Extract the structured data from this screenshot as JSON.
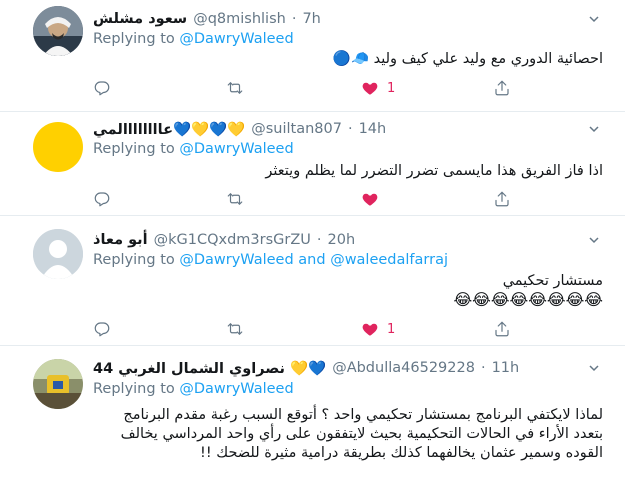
{
  "tweets": [
    {
      "name": "سعود مشلش",
      "handle": "@q8mishlish",
      "time": "7h",
      "replying_prefix": "Replying to",
      "replying_to": "@DawryWaleed",
      "replying_and": "",
      "replying_to2": "",
      "text": "احصائية الدوري مع وليد علي كيف وليد 🧢🔵",
      "text2": "",
      "likes": "1",
      "liked": true
    },
    {
      "name": "عاااااااالمي💙💛💙💛",
      "handle": "@suiltan807",
      "time": "14h",
      "replying_prefix": "Replying to",
      "replying_to": "@DawryWaleed",
      "replying_and": "",
      "replying_to2": "",
      "text": "اذا فاز الفريق هذا مايسمى تضرر التضرر لما يظلم ويتعثر",
      "text2": "",
      "likes": "",
      "liked": true
    },
    {
      "name": "أبو معاذ",
      "handle": "@kG1CQxdm3rsGrZU",
      "time": "20h",
      "replying_prefix": "Replying to",
      "replying_to": "@DawryWaleed",
      "replying_and": "and",
      "replying_to2": "@waleedalfarraj",
      "text": "مستشار تحكيمي",
      "text2": "😂😂😂😂😂😂😂😂",
      "likes": "1",
      "liked": true
    },
    {
      "name": "نصراوي الشمال الغربي 44 💛💙",
      "handle": "@Abdulla46529228",
      "time": "11h",
      "replying_prefix": "Replying to",
      "replying_to": "@DawryWaleed",
      "replying_and": "",
      "replying_to2": "",
      "text": "لماذا لايكتفي البرنامج بمستشار تحكيمي واحد ؟ أتوقع السبب رغبة مقدم البرنامج بتعدد الأراء في الحالات التحكيمية بحيث لايتفقون على رأي واحد المرداسي يخالف القوده وسمير عثمان يخالفهما كذلك بطريقة درامية مثيرة للضحك !!",
      "text2": "",
      "likes": "",
      "liked": false
    }
  ],
  "icons": {
    "more": "chevron-down-icon",
    "reply": "reply-icon",
    "retweet": "retweet-icon",
    "like": "heart-icon",
    "share": "share-icon"
  },
  "colors": {
    "link": "#1da1f2",
    "muted": "#657786",
    "like": "#e0245e",
    "divider": "#e6ecf0"
  }
}
